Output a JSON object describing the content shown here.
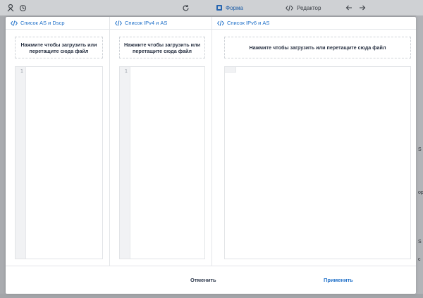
{
  "toolbar": {
    "form_label": "Форма",
    "editor_label": "Редактор"
  },
  "right_fragments": [
    "S",
    "ор",
    "S",
    "с"
  ],
  "columns": [
    {
      "title": "Список AS и Dscp",
      "drop_text": "Нажмите чтобы загрузить или перетащите сюда файл",
      "line_number": "1"
    },
    {
      "title": "Список IPv4 и AS",
      "drop_text": "Нажмите чтобы загрузить или перетащите сюда файл",
      "line_number": "1"
    },
    {
      "title": "Список IPv6 и AS",
      "drop_text": "Нажмите чтобы загрузить или перетащите сюда файл",
      "line_number": ""
    }
  ],
  "footer": {
    "cancel_label": "Отменить",
    "apply_label": "Применить"
  },
  "colors": {
    "accent": "#1e6fc8",
    "dark_text": "#2f3a4d",
    "overlay": "#a9abaf"
  }
}
